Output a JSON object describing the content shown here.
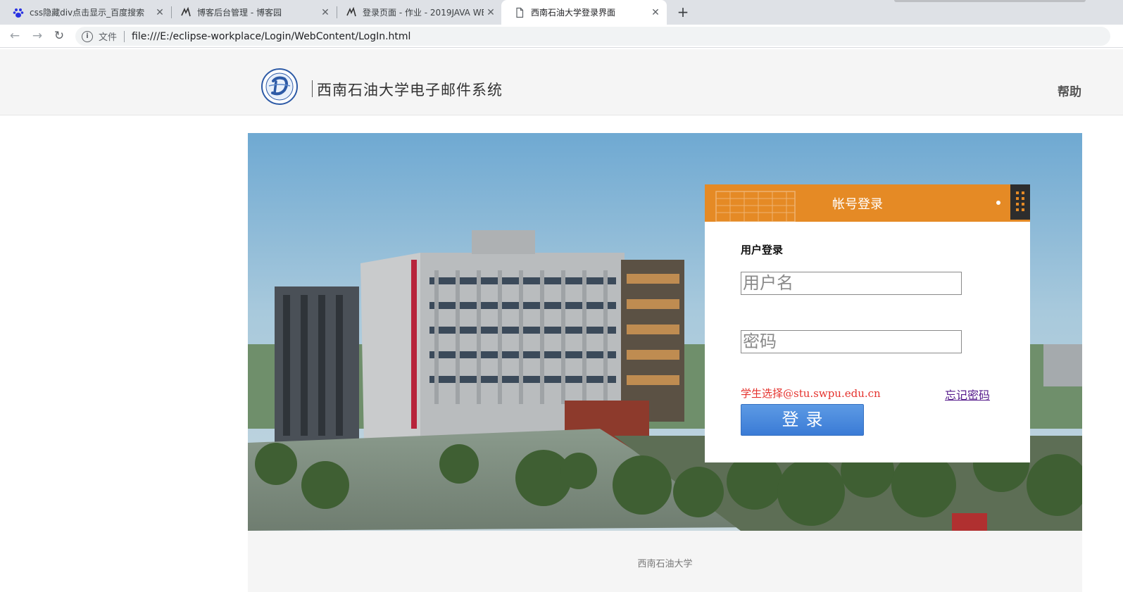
{
  "browser": {
    "tabs": [
      {
        "title": "css隐藏div点击显示_百度搜索",
        "icon": "baidu-paw-icon",
        "close": "✕"
      },
      {
        "title": "博客后台管理 - 博客园",
        "icon": "cnblogs-icon",
        "close": "✕"
      },
      {
        "title": "登录页面 - 作业 - 2019JAVA WE",
        "icon": "cnblogs-icon",
        "close": "✕"
      },
      {
        "title": "西南石油大学登录界面",
        "icon": "page-icon",
        "close": "✕"
      }
    ],
    "new_tab": "+",
    "back": "←",
    "forward": "→",
    "reload": "↻",
    "info_glyph": "i",
    "scheme_label": "文件",
    "url": "file:///E:/eclipse-workplace/Login/WebContent/LogIn.html"
  },
  "header": {
    "site_title": "西南石油大学电子邮件系统",
    "help": "帮助"
  },
  "login": {
    "title": "帐号登录",
    "subtitle": "用户登录",
    "username_placeholder": "用户名",
    "password_placeholder": "密码",
    "hint": "学生选择@stu.swpu.edu.cn",
    "forgot": "忘记密码",
    "submit": "登录"
  },
  "footer": {
    "text": "西南石油大学"
  },
  "colors": {
    "accent_orange": "#e58a25",
    "button_blue": "#3a7bd6",
    "hint_red": "#e5322d",
    "link_purple": "#551a8b"
  }
}
